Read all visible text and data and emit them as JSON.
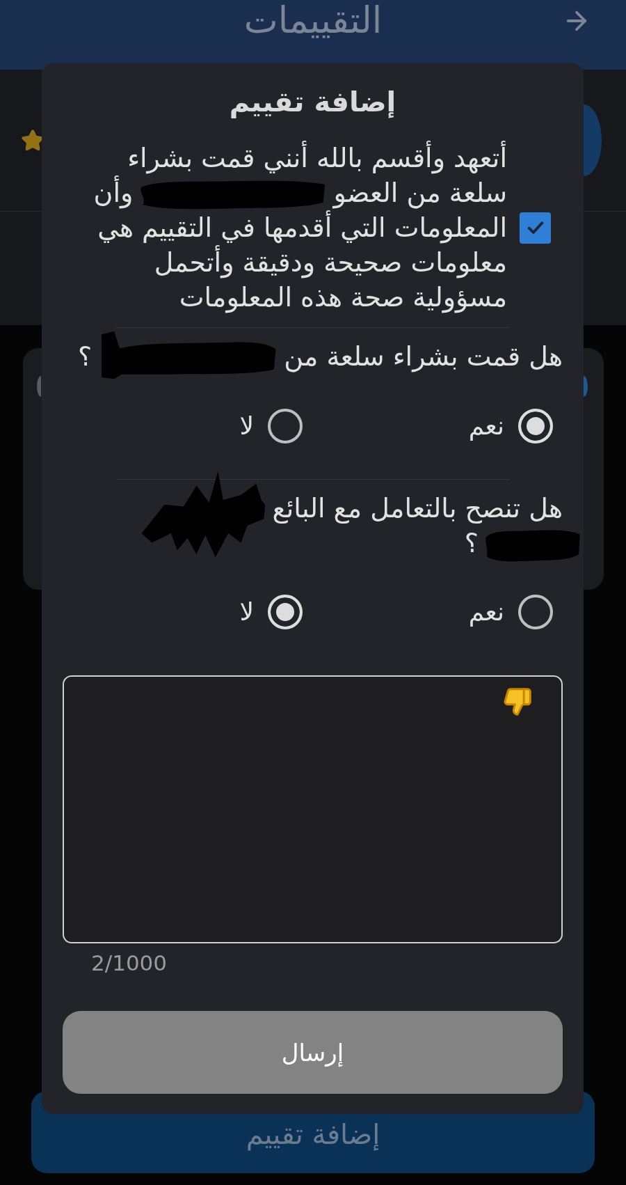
{
  "header": {
    "title": "التقييمات"
  },
  "add_review_button": {
    "label": "إضافة تقييم"
  },
  "dialog": {
    "title": "إضافة تقييم",
    "consent": {
      "checked": true,
      "lines": [
        [
          {
            "kind": "text",
            "text": "أتعهد وأقسم بالله أنني قمت بشراء"
          }
        ],
        [
          {
            "kind": "text",
            "text": "سلعة من العضو"
          },
          {
            "kind": "redaction"
          },
          {
            "kind": "text",
            "text": "وأن"
          }
        ],
        [
          {
            "kind": "text",
            "text": "المعلومات التي أقدمها في التقييم هي معلومات صحيحة ودقيقة وأتحمل مسؤولية صحة هذه المعلومات"
          }
        ]
      ]
    },
    "questions": [
      {
        "lines": [
          [
            {
              "kind": "text",
              "text": "هل قمت بشراء سلعة من"
            },
            {
              "kind": "redaction"
            },
            {
              "kind": "text",
              "text": "؟"
            }
          ]
        ],
        "options": [
          {
            "label": "نعم",
            "selected": true
          },
          {
            "label": "لا",
            "selected": false
          }
        ]
      },
      {
        "lines": [
          [
            {
              "kind": "text",
              "text": "هل تنصح بالتعامل مع البائع"
            },
            {
              "kind": "redaction"
            }
          ],
          [
            {
              "kind": "redaction"
            },
            {
              "kind": "text",
              "text": "؟"
            }
          ]
        ],
        "options": [
          {
            "label": "نعم",
            "selected": false
          },
          {
            "label": "لا",
            "selected": true
          }
        ]
      }
    ],
    "review_field": {
      "counter": "2/1000"
    },
    "submit": {
      "label": "إرسال",
      "disabled": true
    }
  }
}
